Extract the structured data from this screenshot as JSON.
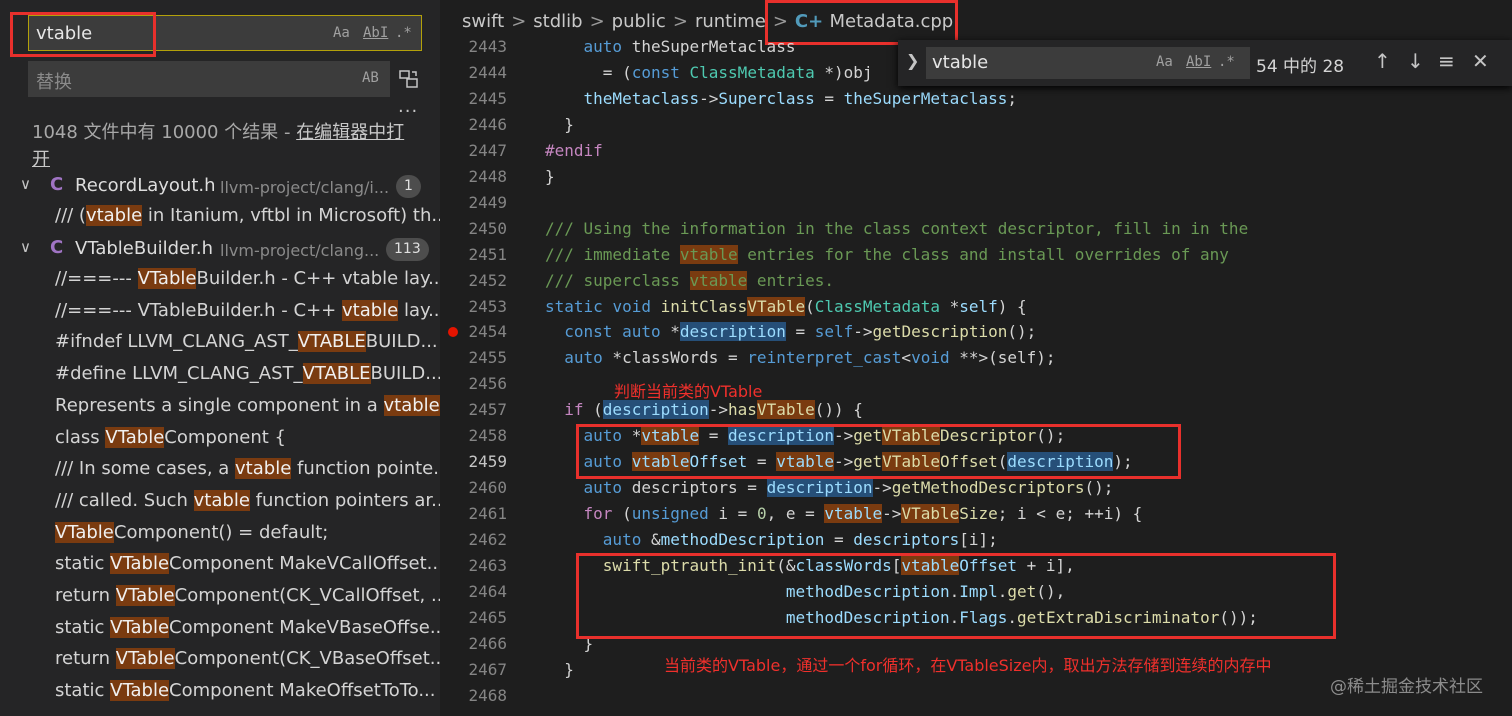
{
  "search": {
    "query": "vtable",
    "match_case_label": "Aa",
    "whole_word_label": "AbI",
    "regex_label": ".*",
    "replace_placeholder": "替换",
    "preserve_case_label": "AB",
    "replace_all_icon": "replace-all-icon",
    "more_label": "...",
    "results_prefix": "1048 文件中有 10000 个结果 - ",
    "open_in_editor": "在编辑器中打开"
  },
  "results": [
    {
      "file": "RecordLayout.h",
      "path": "llvm-project/clang/i...",
      "count": "1",
      "matches": [
        [
          "/// (",
          "vtable",
          " in Itanium, vftbl in Microsoft) th..."
        ]
      ]
    },
    {
      "file": "VTableBuilder.h",
      "path": "llvm-project/clang...",
      "count": "113",
      "matches": [
        [
          "//===--- ",
          "VTable",
          "Builder.h - C++ vtable lay..."
        ],
        [
          "//===--- VTableBuilder.h - C++ ",
          "vtable",
          " lay..."
        ],
        [
          "#ifndef LLVM_CLANG_AST_",
          "VTABLE",
          "BUILD..."
        ],
        [
          "#define LLVM_CLANG_AST_",
          "VTABLE",
          "BUILD..."
        ],
        [
          "Represents a single component in a ",
          "vtable",
          "."
        ],
        [
          "class ",
          "VTable",
          "Component {"
        ],
        [
          "/// In some cases, a ",
          "vtable",
          " function pointe..."
        ],
        [
          "/// called. Such ",
          "vtable",
          " function pointers ar..."
        ],
        [
          "",
          "VTable",
          "Component() = default;"
        ],
        [
          "static ",
          "VTable",
          "Component MakeVCallOffset..."
        ],
        [
          "return ",
          "VTable",
          "Component(CK_VCallOffset, ..."
        ],
        [
          "static ",
          "VTable",
          "Component MakeVBaseOffse..."
        ],
        [
          "return ",
          "VTable",
          "Component(CK_VBaseOffset..."
        ],
        [
          "static ",
          "VTable",
          "Component MakeOffsetToTo..."
        ]
      ]
    }
  ],
  "breadcrumb": [
    "swift",
    "stdlib",
    "public",
    "runtime",
    "Metadata.cpp"
  ],
  "find_widget": {
    "query": "vtable",
    "match_case_label": "Aa",
    "whole_word_label": "AbI",
    "regex_label": ".*",
    "count": "54 中的 28",
    "prev_icon": "arrow-up-icon",
    "next_icon": "arrow-down-icon",
    "selection_icon": "find-in-selection-icon",
    "close_icon": "close-icon"
  },
  "line_numbers": [
    "2443",
    "2444",
    "2445",
    "2446",
    "2447",
    "2448",
    "2449",
    "2450",
    "2451",
    "2452",
    "2453",
    "2454",
    "2455",
    "2456",
    "2457",
    "2458",
    "2459",
    "2460",
    "2461",
    "2462",
    "2463",
    "2464",
    "2465",
    "2466",
    "2467",
    "2468"
  ],
  "active_line": "2459",
  "breakpoint_line": "2454",
  "code": [
    [
      [
        "    ",
        ""
      ],
      [
        "auto",
        "k"
      ],
      [
        " theSuperMetaclass",
        ""
      ]
    ],
    [
      [
        "      = (",
        ""
      ],
      [
        "const",
        "k"
      ],
      [
        " ",
        ""
      ],
      [
        "ClassMetadata",
        "t"
      ],
      [
        " *)obj",
        ""
      ]
    ],
    [
      [
        "    ",
        ""
      ],
      [
        "theMetaclass",
        "v"
      ],
      [
        "->",
        ""
      ],
      [
        "Superclass",
        "v"
      ],
      [
        " = ",
        ""
      ],
      [
        "theSuperMetaclass",
        "v"
      ],
      [
        ";",
        ""
      ]
    ],
    [
      [
        "  }",
        ""
      ]
    ],
    [
      [
        "#endif",
        "p"
      ]
    ],
    [
      [
        "}",
        ""
      ]
    ],
    [
      [
        "",
        ""
      ]
    ],
    [
      [
        "/// Using the information in the class context descriptor, fill in in the",
        "c"
      ]
    ],
    [
      [
        "/// immediate ",
        "c"
      ],
      [
        "vtable",
        "c hm"
      ],
      [
        " entries for the class and install overrides of any",
        "c"
      ]
    ],
    [
      [
        "/// superclass ",
        "c"
      ],
      [
        "vtable",
        "c hm"
      ],
      [
        " entries.",
        "c"
      ]
    ],
    [
      [
        "static",
        "k"
      ],
      [
        " ",
        ""
      ],
      [
        "void",
        "k"
      ],
      [
        " ",
        ""
      ],
      [
        "initClass",
        "f"
      ],
      [
        "VTable",
        "f hm"
      ],
      [
        "(",
        ""
      ],
      [
        "ClassMetadata",
        "t"
      ],
      [
        " *",
        ""
      ],
      [
        "self",
        "v"
      ],
      [
        ") {",
        ""
      ]
    ],
    [
      [
        "  ",
        ""
      ],
      [
        "const",
        "k"
      ],
      [
        " ",
        ""
      ],
      [
        "auto",
        "k"
      ],
      [
        " *",
        ""
      ],
      [
        "description",
        "v hs"
      ],
      [
        " = ",
        ""
      ],
      [
        "self",
        "k"
      ],
      [
        "->",
        ""
      ],
      [
        "getDescription",
        "f"
      ],
      [
        "();",
        ""
      ]
    ],
    [
      [
        "  ",
        ""
      ],
      [
        "auto",
        "k"
      ],
      [
        " *classWords = ",
        ""
      ],
      [
        "reinterpret_cast",
        "k"
      ],
      [
        "<",
        ""
      ],
      [
        "void",
        "k"
      ],
      [
        " **>(self);",
        ""
      ]
    ],
    [
      [
        "",
        ""
      ]
    ],
    [
      [
        "  ",
        ""
      ],
      [
        "if",
        "p"
      ],
      [
        " (",
        ""
      ],
      [
        "description",
        "v hs"
      ],
      [
        "->",
        ""
      ],
      [
        "has",
        "f"
      ],
      [
        "VTable",
        "f hm"
      ],
      [
        "()) {",
        ""
      ]
    ],
    [
      [
        "    ",
        ""
      ],
      [
        "auto",
        "k"
      ],
      [
        " *",
        ""
      ],
      [
        "vtable",
        "v hm"
      ],
      [
        " = ",
        ""
      ],
      [
        "description",
        "v hs"
      ],
      [
        "->",
        ""
      ],
      [
        "get",
        "f"
      ],
      [
        "VTable",
        "f hm"
      ],
      [
        "Descriptor",
        "f"
      ],
      [
        "();",
        ""
      ]
    ],
    [
      [
        "    ",
        ""
      ],
      [
        "auto",
        "k"
      ],
      [
        " ",
        ""
      ],
      [
        "vtable",
        "v hm"
      ],
      [
        "Offset",
        "v"
      ],
      [
        " = ",
        ""
      ],
      [
        "vtable",
        "v hm"
      ],
      [
        "->",
        ""
      ],
      [
        "get",
        "f"
      ],
      [
        "VTable",
        "f hm"
      ],
      [
        "Offset",
        "f"
      ],
      [
        "(",
        ""
      ],
      [
        "description",
        "v hs"
      ],
      [
        ");",
        ""
      ]
    ],
    [
      [
        "    ",
        ""
      ],
      [
        "auto",
        "k"
      ],
      [
        " descriptors = ",
        ""
      ],
      [
        "description",
        "v hs"
      ],
      [
        "->",
        ""
      ],
      [
        "getMethodDescriptors",
        "f"
      ],
      [
        "();",
        ""
      ]
    ],
    [
      [
        "    ",
        ""
      ],
      [
        "for",
        "p"
      ],
      [
        " (",
        ""
      ],
      [
        "unsigned",
        "k"
      ],
      [
        " i = ",
        ""
      ],
      [
        "0",
        "n"
      ],
      [
        ", e = ",
        ""
      ],
      [
        "vtable",
        "v hm"
      ],
      [
        "->",
        ""
      ],
      [
        "VTable",
        "f hm"
      ],
      [
        "Size",
        "f"
      ],
      [
        "; i < e; ++i) {",
        ""
      ]
    ],
    [
      [
        "      ",
        ""
      ],
      [
        "auto",
        "k"
      ],
      [
        " &",
        ""
      ],
      [
        "methodDescription",
        "v"
      ],
      [
        " = ",
        ""
      ],
      [
        "descriptors",
        "v"
      ],
      [
        "[i];",
        ""
      ]
    ],
    [
      [
        "      ",
        ""
      ],
      [
        "swift_ptrauth_init",
        "f"
      ],
      [
        "(&",
        ""
      ],
      [
        "classWords",
        "v"
      ],
      [
        "[",
        ""
      ],
      [
        "vtable",
        "v hm"
      ],
      [
        "Offset",
        "v"
      ],
      [
        " + i],",
        ""
      ]
    ],
    [
      [
        "                         ",
        ""
      ],
      [
        "methodDescription",
        "v"
      ],
      [
        ".",
        ""
      ],
      [
        "Impl",
        "v"
      ],
      [
        ".",
        ""
      ],
      [
        "get",
        "f"
      ],
      [
        "(),",
        ""
      ]
    ],
    [
      [
        "                         ",
        ""
      ],
      [
        "methodDescription",
        "v"
      ],
      [
        ".",
        ""
      ],
      [
        "Flags",
        "v"
      ],
      [
        ".",
        ""
      ],
      [
        "getExtraDiscriminator",
        "f"
      ],
      [
        "());",
        ""
      ]
    ],
    [
      [
        "    }",
        ""
      ]
    ],
    [
      [
        "  }",
        ""
      ]
    ],
    [
      [
        "",
        ""
      ]
    ]
  ],
  "annotations": {
    "note1": "判断当前类的VTable",
    "note2": "当前类的VTable，通过一个for循环，在VTableSize内，取出方法存储到连续的内存中"
  },
  "watermark": "@稀土掘金技术社区",
  "colors": {
    "highlight_match": "#7a3b10",
    "annotation_red": "#e8302c",
    "find_border": "#b3a10a"
  }
}
